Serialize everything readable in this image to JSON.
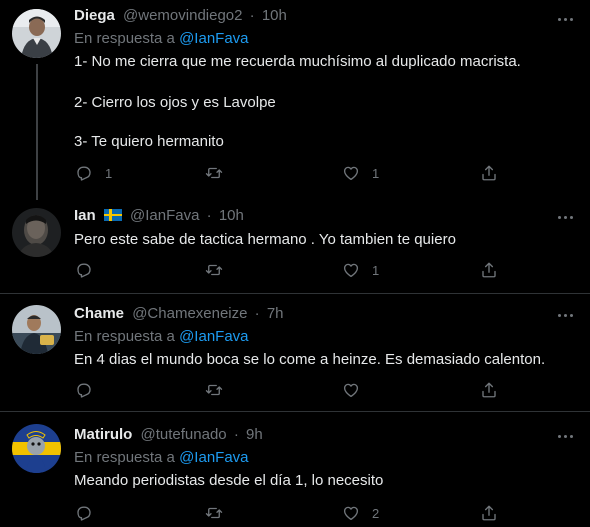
{
  "tweets": [
    {
      "name": "Diega",
      "handle": "@wemovindiego2",
      "time": "10h",
      "reply_prefix": "En respuesta a",
      "reply_to": "@IanFava",
      "lines": [
        "1- No me cierra que me recuerda muchísimo al duplicado macrista.",
        "2- Cierro los ojos y es Lavolpe",
        "3- Te quiero hermanito"
      ],
      "replies": "1",
      "retweets": "",
      "likes": "1"
    },
    {
      "name": "Ian",
      "handle": "@IanFava",
      "time": "10h",
      "lines": [
        "Pero este sabe de tactica hermano . Yo tambien te quiero"
      ],
      "replies": "",
      "retweets": "",
      "likes": "1"
    },
    {
      "name": "Chame",
      "handle": "@Chamexeneize",
      "time": "7h",
      "reply_prefix": "En respuesta a",
      "reply_to": "@IanFava",
      "lines": [
        "En 4 dias el mundo boca se lo come a heinze. Es demasiado calenton."
      ],
      "replies": "",
      "retweets": "",
      "likes": ""
    },
    {
      "name": "Matirulo",
      "handle": "@tutefunado",
      "time": "9h",
      "reply_prefix": "En respuesta a",
      "reply_to": "@IanFava",
      "lines": [
        "Meando periodistas desde el día 1, lo necesito"
      ],
      "replies": "",
      "retweets": "",
      "likes": "2"
    }
  ],
  "separator": "·",
  "icons": [
    "reply-icon",
    "retweet-icon",
    "like-icon",
    "share-icon",
    "more-icon",
    "sweden-flag-icon"
  ],
  "colors": {
    "background": "#000000",
    "text": "#e7e9ea",
    "muted": "#71767b",
    "mention": "#1d9bf0",
    "divider": "#2f3336"
  }
}
